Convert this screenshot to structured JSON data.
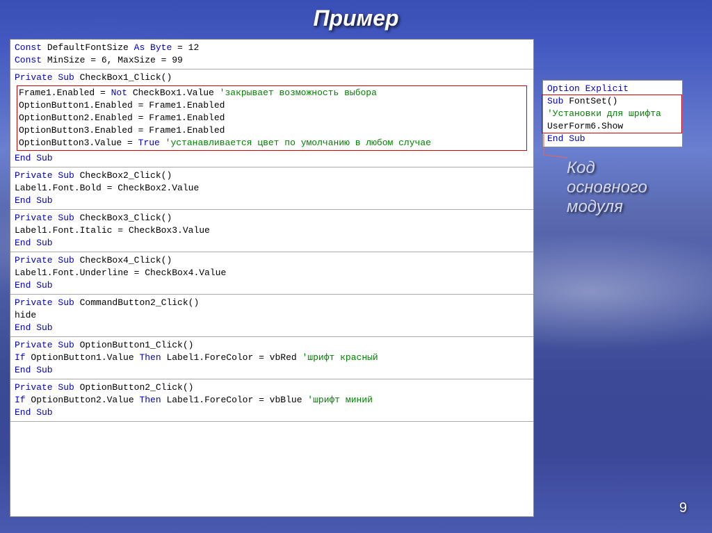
{
  "title": "Пример",
  "annotation": "Код\nосновного\nмодуля",
  "page": "9",
  "main_sections": [
    {
      "lines": [
        [
          {
            "c": "kw",
            "t": "Const "
          },
          {
            "c": "txt",
            "t": "DefaultFontSize "
          },
          {
            "c": "kw",
            "t": "As Byte"
          },
          {
            "c": "txt",
            "t": " = 12"
          }
        ],
        [
          {
            "c": "kw",
            "t": "Const "
          },
          {
            "c": "txt",
            "t": "MinSize = 6, MaxSize = 99"
          }
        ]
      ]
    },
    {
      "lines": [
        [
          {
            "c": "txt",
            "t": ""
          }
        ],
        [
          {
            "c": "kw",
            "t": "Private Sub "
          },
          {
            "c": "txt",
            "t": "CheckBox1_Click()"
          }
        ]
      ],
      "redbox": [
        [
          {
            "c": "txt",
            "t": "Frame1.Enabled = "
          },
          {
            "c": "kw",
            "t": "Not"
          },
          {
            "c": "txt",
            "t": " CheckBox1.Value "
          },
          {
            "c": "cm",
            "t": "'закрывает возможность выбора"
          }
        ],
        [
          {
            "c": "txt",
            "t": "OptionButton1.Enabled = Frame1.Enabled"
          }
        ],
        [
          {
            "c": "txt",
            "t": "OptionButton2.Enabled = Frame1.Enabled"
          }
        ],
        [
          {
            "c": "txt",
            "t": "OptionButton3.Enabled = Frame1.Enabled"
          }
        ],
        [
          {
            "c": "txt",
            "t": "OptionButton3.Value = "
          },
          {
            "c": "kw",
            "t": "True "
          },
          {
            "c": "cm",
            "t": "'устанавливается цвет по умолчанию в любом случае"
          }
        ]
      ],
      "after": [
        [
          {
            "c": "kw",
            "t": "End Sub"
          }
        ]
      ]
    },
    {
      "lines": [
        [
          {
            "c": "kw",
            "t": "Private Sub "
          },
          {
            "c": "txt",
            "t": "CheckBox2_Click()"
          }
        ],
        [
          {
            "c": "txt",
            "t": "Label1.Font.Bold = CheckBox2.Value"
          }
        ],
        [
          {
            "c": "kw",
            "t": "End Sub"
          }
        ]
      ]
    },
    {
      "lines": [
        [
          {
            "c": "txt",
            "t": ""
          }
        ],
        [
          {
            "c": "kw",
            "t": "Private Sub "
          },
          {
            "c": "txt",
            "t": "CheckBox3_Click()"
          }
        ],
        [
          {
            "c": "txt",
            "t": "Label1.Font.Italic = CheckBox3.Value"
          }
        ],
        [
          {
            "c": "kw",
            "t": "End Sub"
          }
        ]
      ]
    },
    {
      "lines": [
        [
          {
            "c": "kw",
            "t": "Private Sub "
          },
          {
            "c": "txt",
            "t": "CheckBox4_Click()"
          }
        ],
        [
          {
            "c": "txt",
            "t": "Label1.Font.Underline = CheckBox4.Value"
          }
        ],
        [
          {
            "c": "kw",
            "t": "End Sub"
          }
        ]
      ]
    },
    {
      "lines": [
        [
          {
            "c": "txt",
            "t": ""
          }
        ],
        [
          {
            "c": "kw",
            "t": "Private Sub "
          },
          {
            "c": "txt",
            "t": "CommandButton2_Click()"
          }
        ],
        [
          {
            "c": "txt",
            "t": "hide"
          }
        ],
        [
          {
            "c": "kw",
            "t": "End Sub"
          }
        ]
      ]
    },
    {
      "lines": [
        [
          {
            "c": "txt",
            "t": ""
          }
        ],
        [
          {
            "c": "kw",
            "t": "Private Sub "
          },
          {
            "c": "txt",
            "t": "OptionButton1_Click()"
          }
        ],
        [
          {
            "c": "kw",
            "t": "If "
          },
          {
            "c": "txt",
            "t": "OptionButton1.Value "
          },
          {
            "c": "kw",
            "t": "Then"
          },
          {
            "c": "txt",
            "t": " Label1.ForeColor = vbRed "
          },
          {
            "c": "cm",
            "t": "'шрифт красный"
          }
        ],
        [
          {
            "c": "kw",
            "t": "End Sub"
          }
        ]
      ]
    },
    {
      "lines": [
        [
          {
            "c": "txt",
            "t": ""
          }
        ],
        [
          {
            "c": "kw",
            "t": "Private Sub "
          },
          {
            "c": "txt",
            "t": "OptionButton2_Click()"
          }
        ],
        [
          {
            "c": "kw",
            "t": "If "
          },
          {
            "c": "txt",
            "t": "OptionButton2.Value "
          },
          {
            "c": "kw",
            "t": "Then"
          },
          {
            "c": "txt",
            "t": " Label1.ForeColor = vbBlue "
          },
          {
            "c": "cm",
            "t": "'шрифт миний"
          }
        ],
        [
          {
            "c": "kw",
            "t": "End Sub"
          }
        ]
      ]
    },
    {
      "lines": [
        [
          {
            "c": "txt",
            "t": ""
          }
        ]
      ]
    }
  ],
  "side_lines": [
    [
      {
        "c": "kw",
        "t": "Option Explicit"
      }
    ],
    [
      {
        "c": "kw",
        "t": "Sub "
      },
      {
        "c": "txt",
        "t": "FontSet()"
      }
    ],
    [
      {
        "c": "cm",
        "t": "'Установки для шрифта"
      }
    ],
    [
      {
        "c": "txt",
        "t": "UserForm6.Show"
      }
    ],
    [
      {
        "c": "kw",
        "t": "End Sub"
      }
    ]
  ]
}
